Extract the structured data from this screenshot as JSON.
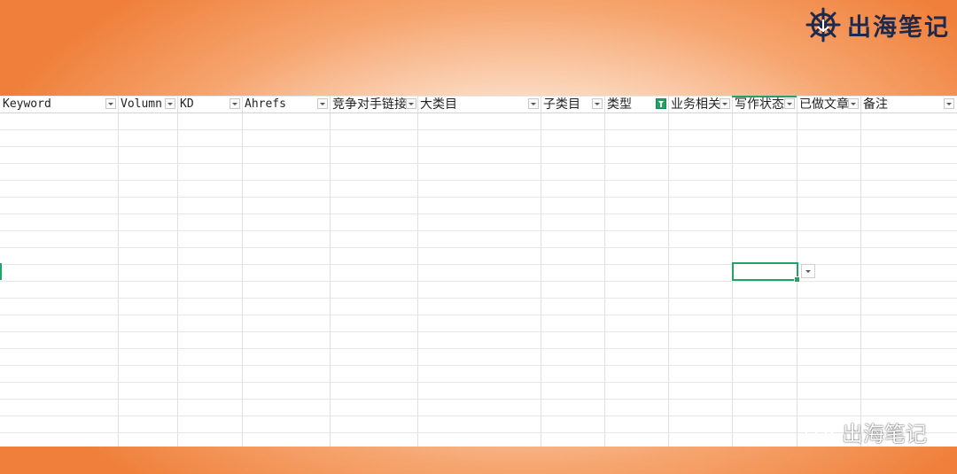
{
  "brand": {
    "logo_text": "出海笔记",
    "watermark_text": "出海笔记",
    "icons": {
      "logo": "ship-wheel-anchor-icon",
      "watermark": "wechat-icon"
    }
  },
  "sheet": {
    "columns": [
      {
        "key": "keyword",
        "label": "Keyword"
      },
      {
        "key": "volume",
        "label": "Volumn"
      },
      {
        "key": "kd",
        "label": "KD"
      },
      {
        "key": "ahrefs",
        "label": "Ahrefs"
      },
      {
        "key": "competitor_link",
        "label": "竞争对手链接"
      },
      {
        "key": "main_category",
        "label": "大类目"
      },
      {
        "key": "sub_category",
        "label": "子类目"
      },
      {
        "key": "type",
        "label": "类型"
      },
      {
        "key": "business_relevance",
        "label": "业务相关"
      },
      {
        "key": "writing_status",
        "label": "写作状态"
      },
      {
        "key": "done_article",
        "label": "已做文章"
      },
      {
        "key": "notes",
        "label": "备注"
      }
    ],
    "filtered_column": "类型",
    "active_column": "写作状态"
  },
  "colors": {
    "accent": "#21a366",
    "background_orange": "#ef7f3a",
    "logo_navy": "#1d2a4d"
  }
}
